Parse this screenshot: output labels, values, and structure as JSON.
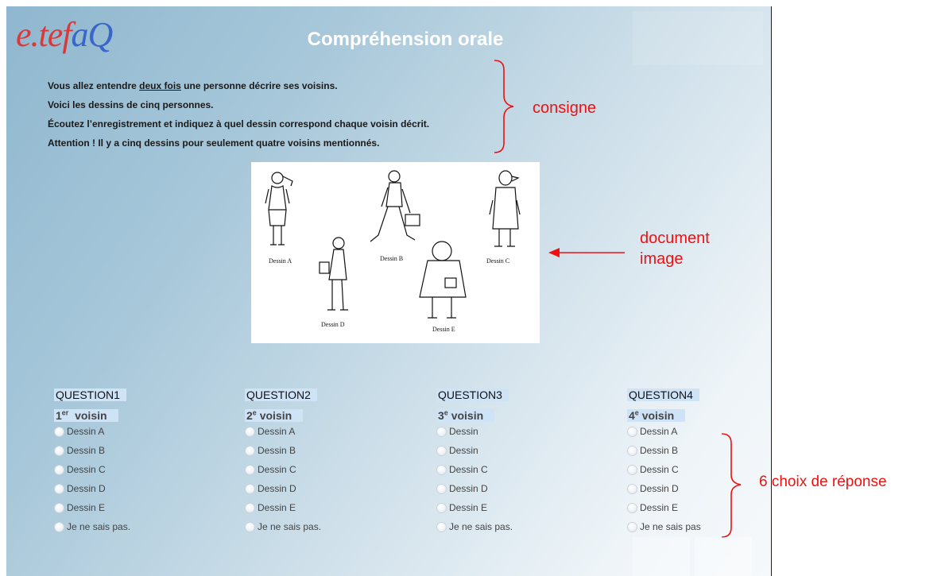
{
  "logo": {
    "part1": "e.tef",
    "part2": "aQ"
  },
  "title": "Compréhension orale",
  "instructions": {
    "line1_pre": "Vous allez entendre ",
    "line1_u": "deux fois",
    "line1_post": " une personne décrire ses voisins.",
    "line2": "Voici les dessins de cinq personnes.",
    "line3": "Écoutez l’enregistrement et indiquez à quel dessin correspond chaque voisin décrit.",
    "line4": "Attention ! Il y a cinq dessins pour seulement quatre voisins mentionnés."
  },
  "annotations": {
    "consigne": "consigne",
    "document_line1": "document",
    "document_line2": "image",
    "choices": "6 choix de réponse"
  },
  "document": {
    "labels": [
      "Dessin A",
      "Dessin B",
      "Dessin C",
      "Dessin D",
      "Dessin E"
    ]
  },
  "questions": [
    {
      "head": "QUESTION",
      "num": "1",
      "sub_num": "1",
      "sub_sup": "er",
      "sub_word": "voisin",
      "options": [
        "Dessin A",
        "Dessin B",
        "Dessin C",
        "Dessin D",
        "Dessin E",
        "Je ne sais pas."
      ]
    },
    {
      "head": "QUESTION",
      "num": "2",
      "sub_num": "2",
      "sub_sup": "e",
      "sub_word": "voisin",
      "options": [
        "Dessin A",
        "Dessin B",
        "Dessin C",
        "Dessin D",
        "Dessin E",
        "Je ne sais pas."
      ]
    },
    {
      "head": "QUESTION",
      "num": "3",
      "sub_num": "3",
      "sub_sup": "e",
      "sub_word": "voisin",
      "options": [
        "Dessin",
        "Dessin",
        "Dessin C",
        "Dessin D",
        "Dessin E",
        "Je ne sais pas."
      ]
    },
    {
      "head": "QUESTION",
      "num": "4",
      "sub_num": "4",
      "sub_sup": "e",
      "sub_word": "voisin",
      "options": [
        "Dessin A",
        "Dessin B",
        "Dessin C",
        "Dessin D",
        "Dessin E",
        "Je ne sais pas"
      ]
    }
  ]
}
